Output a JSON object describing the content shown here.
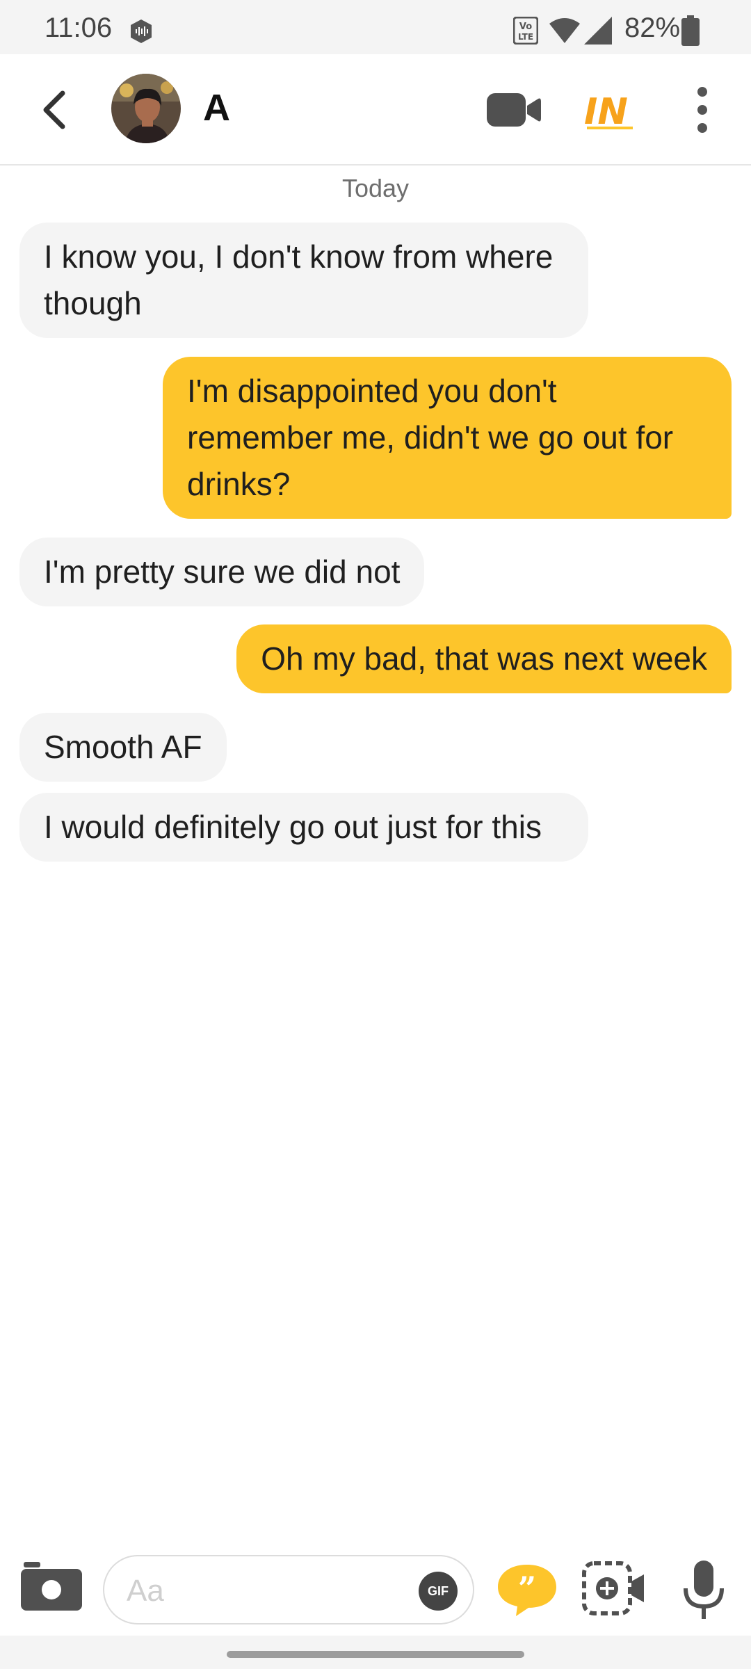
{
  "status_bar": {
    "time": "11:06",
    "battery_percent": "82%",
    "icons": [
      "podcast-app-icon",
      "volte-icon",
      "wifi-icon",
      "signal-icon",
      "battery-icon"
    ]
  },
  "header": {
    "contact_name": "A",
    "icons": [
      "back-arrow-icon",
      "avatar",
      "video-call-icon",
      "in-badge-icon",
      "more-vert-icon"
    ],
    "in_badge_text": "IN"
  },
  "chat": {
    "date_label": "Today",
    "messages": [
      {
        "direction": "incoming",
        "text": "I know you,  I don't know from where though"
      },
      {
        "direction": "outgoing",
        "text": "I'm disappointed you don't remember me, didn't we go out for drinks?"
      },
      {
        "direction": "incoming",
        "text": "I'm pretty sure we did not"
      },
      {
        "direction": "outgoing",
        "text": "Oh my bad, that was next week"
      },
      {
        "direction": "incoming",
        "text": "Smooth AF"
      },
      {
        "direction": "incoming",
        "text": "I would definitely go out just for this"
      }
    ]
  },
  "composer": {
    "placeholder": "Aa",
    "value": "",
    "gif_label": "GIF",
    "icons": [
      "camera-icon",
      "quote-icon",
      "media-add-icon",
      "microphone-icon"
    ]
  },
  "colors": {
    "accent": "#fdc52b",
    "incoming_bubble": "#f4f4f4",
    "outgoing_bubble": "#fdc52b"
  }
}
